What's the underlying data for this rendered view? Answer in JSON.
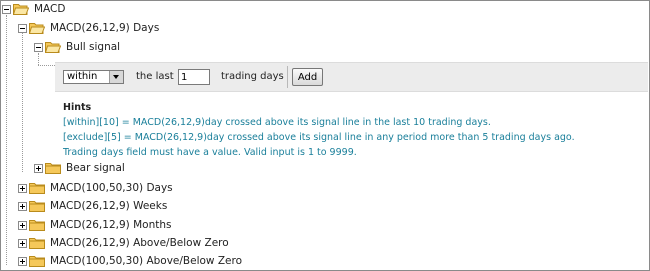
{
  "tree": {
    "root": {
      "label": "MACD"
    },
    "macd_days": {
      "label": "MACD(26,12,9) Days"
    },
    "bull_signal": {
      "label": "Bull signal"
    },
    "bear_signal": {
      "label": "Bear signal"
    },
    "siblings": [
      {
        "label": "MACD(100,50,30) Days"
      },
      {
        "label": "MACD(26,12,9) Weeks"
      },
      {
        "label": "MACD(26,12,9) Months"
      },
      {
        "label": "MACD(26,12,9) Above/Below Zero"
      },
      {
        "label": "MACD(100,50,30) Above/Below Zero"
      }
    ]
  },
  "criteria": {
    "mode_value": "within",
    "the_last_label": "the last",
    "days_value": "1",
    "trading_days_label": "trading days",
    "add_label": "Add"
  },
  "hints": {
    "title": "Hints",
    "lines": [
      "[within][10] = MACD(26,12,9)day crossed above its signal line in the last 10 trading days.",
      "[exclude][5] = MACD(26,12,9)day crossed above its signal line in any period more than 5 trading days ago.",
      "Trading days field must have a value. Valid input is 1 to 9999."
    ]
  },
  "colors": {
    "folder": "#f5c85a",
    "hint_text": "#1a7f9a",
    "panel_bg": "#ececec"
  }
}
